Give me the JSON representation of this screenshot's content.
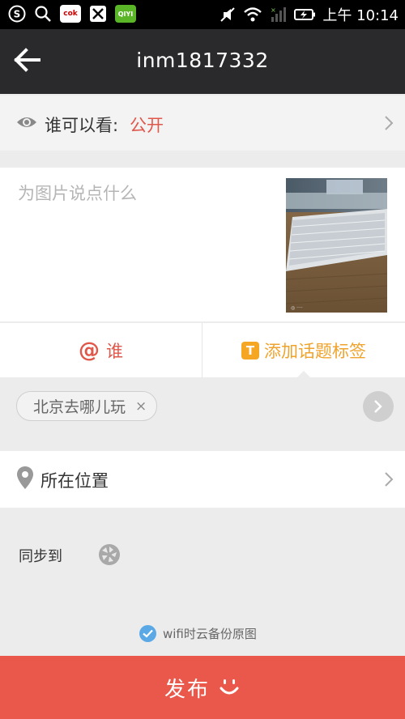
{
  "status_bar": {
    "time": "上午 10:14",
    "app_icons": [
      "sogou-icon",
      "search-icon",
      "cok-icon",
      "game-icon",
      "iqiyi-icon"
    ],
    "cok_label": "cok",
    "iqiyi_label": "QIYI"
  },
  "header": {
    "title": "inm1817332"
  },
  "visibility": {
    "label": "谁可以看:",
    "value": "公开"
  },
  "caption": {
    "placeholder": "为图片说点什么"
  },
  "actions": {
    "mention_symbol": "@",
    "mention_label": "谁",
    "topic_badge": "T",
    "topic_label": "添加话题标签"
  },
  "tags": {
    "items": [
      "北京去哪儿玩"
    ],
    "remove_symbol": "×"
  },
  "location": {
    "label": "所在位置"
  },
  "sync": {
    "label": "同步到"
  },
  "wifi_backup": {
    "label": "wifi时云备份原图",
    "checked": true
  },
  "publish": {
    "label": "发布"
  },
  "colors": {
    "accent_red": "#e9584b",
    "topic_orange": "#f5a623",
    "check_blue": "#5aa9e6",
    "header_bg": "#2a2a2d"
  }
}
